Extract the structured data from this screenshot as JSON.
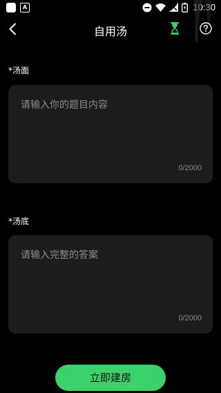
{
  "status_bar": {
    "time": "10:30",
    "icons": [
      "app-icon",
      "app-a-icon",
      "dnd-icon",
      "wifi-icon",
      "signal-icon",
      "battery-icon"
    ]
  },
  "header": {
    "title": "自用汤",
    "icons": [
      "back-icon",
      "hourglass-icon",
      "help-icon"
    ],
    "accent_color": "#3bd26b"
  },
  "soup_surface": {
    "label": "*汤面",
    "placeholder": "请输入你的题目内容",
    "counter": "0/2000"
  },
  "soup_bottom": {
    "label": "*汤底",
    "placeholder": "请输入完整的答案",
    "counter": "0/2000"
  },
  "create_button": {
    "label": "立即建房",
    "color": "#3bd26b"
  }
}
